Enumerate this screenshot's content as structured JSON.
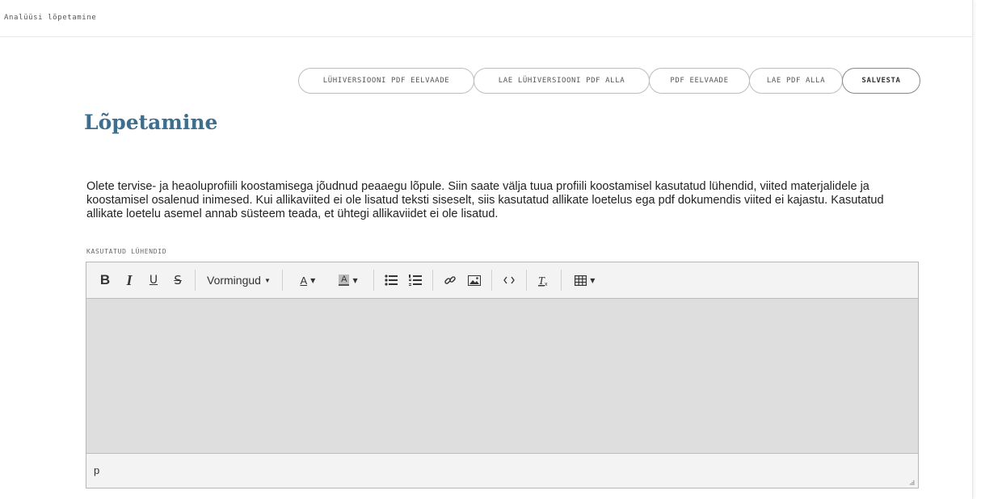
{
  "breadcrumb": "Analüüsi lõpetamine",
  "buttons": {
    "short_pdf_preview": "LÜHIVERSIOONI PDF EELVAADE",
    "short_pdf_download": "LAE LÜHIVERSIOONI PDF ALLA",
    "pdf_preview": "PDF EELVAADE",
    "pdf_download": "LAE PDF ALLA",
    "save": "SALVESTA"
  },
  "page_title": "Lõpetamine",
  "intro_text": "Olete tervise- ja heaoluprofiili koostamisega jõudnud peaaegu lõpule. Siin saate välja tuua profiili koostamisel kasutatud lühendid, viited materjalidele ja koostamisel osalenud inimesed. Kui allikaviited ei ole lisatud teksti siseselt, siis kasutatud allikate loetelus ega pdf dokumendis viited ei kajastu. Kasutatud allikate loetelu asemel annab süsteem teada, et ühtegi allikaviidet ei ole lisatud.",
  "field_label": "KASUTATUD LÜHENDID",
  "editor": {
    "toolbar": {
      "bold": "B",
      "italic": "I",
      "underline": "U",
      "strike": "S",
      "formats": "Vormingud",
      "text_color": "A",
      "bg_color": "A",
      "table_caret": "▾"
    },
    "content": "",
    "status_path": "p"
  },
  "icons": {
    "bullet_list": "bullet-list-icon",
    "numbered_list": "numbered-list-icon",
    "link": "link-icon",
    "image": "image-icon",
    "code": "code-icon",
    "clear_format": "clear-format-icon",
    "table": "table-icon",
    "resize": "resize-grip-icon"
  }
}
